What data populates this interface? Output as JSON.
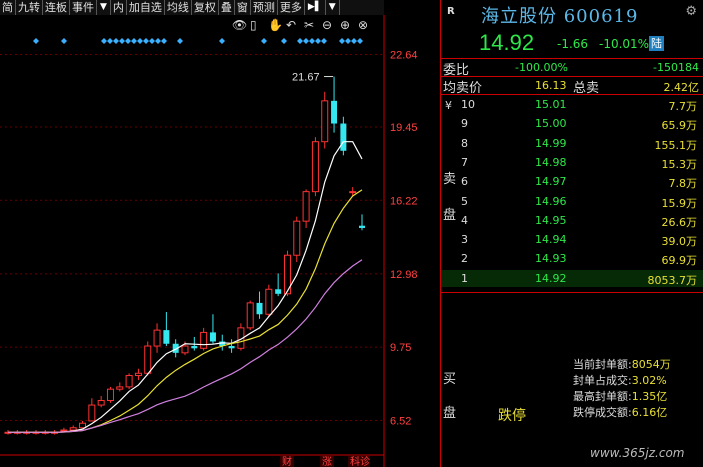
{
  "toolbar": {
    "items": [
      "简",
      "九转",
      "连板",
      "事件",
      "内",
      "加自选",
      "均线",
      "复权",
      "叠",
      "窗",
      "预测",
      "更多"
    ],
    "menu_arrow": "▼",
    "icon_glyph": "▶▌",
    "dropdown": "▼"
  },
  "chart_tools": [
    "👁",
    "▯",
    "✋",
    "↶",
    "✂",
    "⊖",
    "⊕",
    "⊗"
  ],
  "chart_data": {
    "type": "candlestick",
    "y_ticks": [
      "22.64",
      "19.45",
      "16.22",
      "12.98",
      "9.75",
      "6.52"
    ],
    "annotation": "21.67",
    "bottom_markers": [
      "财",
      "涨",
      "科诊"
    ],
    "candles": [
      {
        "o": 6.0,
        "h": 6.1,
        "l": 5.9,
        "c": 6.0
      },
      {
        "o": 6.0,
        "h": 6.1,
        "l": 5.9,
        "c": 6.0
      },
      {
        "o": 6.0,
        "h": 6.1,
        "l": 5.9,
        "c": 6.0
      },
      {
        "o": 6.0,
        "h": 6.1,
        "l": 5.9,
        "c": 6.0
      },
      {
        "o": 6.0,
        "h": 6.1,
        "l": 5.9,
        "c": 6.0
      },
      {
        "o": 6.0,
        "h": 6.1,
        "l": 5.9,
        "c": 6.0
      },
      {
        "o": 6.1,
        "h": 6.2,
        "l": 6.0,
        "c": 6.1
      },
      {
        "o": 6.1,
        "h": 6.3,
        "l": 6.1,
        "c": 6.2
      },
      {
        "o": 6.2,
        "h": 6.5,
        "l": 6.2,
        "c": 6.4
      },
      {
        "o": 6.5,
        "h": 7.5,
        "l": 6.5,
        "c": 7.2
      },
      {
        "o": 7.2,
        "h": 7.6,
        "l": 7.1,
        "c": 7.4
      },
      {
        "o": 7.4,
        "h": 8.0,
        "l": 7.3,
        "c": 7.9
      },
      {
        "o": 7.9,
        "h": 8.2,
        "l": 7.8,
        "c": 8.0
      },
      {
        "o": 8.0,
        "h": 8.6,
        "l": 7.9,
        "c": 8.5
      },
      {
        "o": 8.5,
        "h": 8.8,
        "l": 8.3,
        "c": 8.6
      },
      {
        "o": 8.6,
        "h": 10.0,
        "l": 8.5,
        "c": 9.8
      },
      {
        "o": 9.8,
        "h": 10.8,
        "l": 9.5,
        "c": 10.5
      },
      {
        "o": 10.5,
        "h": 11.3,
        "l": 9.8,
        "c": 9.9
      },
      {
        "o": 9.9,
        "h": 10.1,
        "l": 9.3,
        "c": 9.5
      },
      {
        "o": 9.5,
        "h": 10.0,
        "l": 9.4,
        "c": 9.8
      },
      {
        "o": 9.8,
        "h": 10.2,
        "l": 9.6,
        "c": 9.7
      },
      {
        "o": 9.7,
        "h": 10.6,
        "l": 9.6,
        "c": 10.4
      },
      {
        "o": 10.4,
        "h": 11.2,
        "l": 9.9,
        "c": 10.0
      },
      {
        "o": 10.0,
        "h": 10.3,
        "l": 9.6,
        "c": 9.8
      },
      {
        "o": 9.8,
        "h": 10.1,
        "l": 9.5,
        "c": 9.7
      },
      {
        "o": 9.7,
        "h": 10.8,
        "l": 9.6,
        "c": 10.6
      },
      {
        "o": 10.6,
        "h": 11.8,
        "l": 10.5,
        "c": 11.7
      },
      {
        "o": 11.7,
        "h": 12.2,
        "l": 11.0,
        "c": 11.2
      },
      {
        "o": 11.2,
        "h": 12.5,
        "l": 11.1,
        "c": 12.3
      },
      {
        "o": 12.3,
        "h": 13.0,
        "l": 12.0,
        "c": 12.1
      },
      {
        "o": 12.1,
        "h": 14.0,
        "l": 12.0,
        "c": 13.8
      },
      {
        "o": 13.8,
        "h": 15.5,
        "l": 13.5,
        "c": 15.3
      },
      {
        "o": 15.3,
        "h": 16.7,
        "l": 15.0,
        "c": 16.6
      },
      {
        "o": 16.6,
        "h": 19.0,
        "l": 16.4,
        "c": 18.8
      },
      {
        "o": 18.8,
        "h": 21.0,
        "l": 18.5,
        "c": 20.6
      },
      {
        "o": 20.6,
        "h": 21.67,
        "l": 19.2,
        "c": 19.6
      },
      {
        "o": 19.6,
        "h": 19.9,
        "l": 18.2,
        "c": 18.4
      },
      {
        "o": 16.6,
        "h": 16.8,
        "l": 16.4,
        "c": 16.6
      },
      {
        "o": 15.1,
        "h": 15.6,
        "l": 14.9,
        "c": 15.0
      }
    ]
  },
  "stock": {
    "market_tag": "R",
    "name": "海立股份",
    "code": "600619",
    "settings_icon": "⚙",
    "price": "14.92",
    "change": "-1.66",
    "change_pct": "-10.01%",
    "badge": "陆",
    "weibi_label": "委比",
    "weibi_value": "-100.00%",
    "weicha_value": "-150184",
    "avg_label": "均卖价",
    "avg_value": "16.13",
    "total_label": "总卖",
    "total_value": "2.42亿",
    "currency": "¥",
    "sell_label_1": "卖",
    "sell_label_2": "盘",
    "buy_label_1": "买",
    "buy_label_2": "盘",
    "limit_text": "跌停"
  },
  "orderbook": [
    {
      "level": "10",
      "price": "15.01",
      "vol": "7.7万"
    },
    {
      "level": "9",
      "price": "15.00",
      "vol": "65.9万"
    },
    {
      "level": "8",
      "price": "14.99",
      "vol": "155.1万"
    },
    {
      "level": "7",
      "price": "14.98",
      "vol": "15.3万"
    },
    {
      "level": "6",
      "price": "14.97",
      "vol": "7.8万"
    },
    {
      "level": "5",
      "price": "14.96",
      "vol": "15.9万"
    },
    {
      "level": "4",
      "price": "14.95",
      "vol": "26.6万"
    },
    {
      "level": "3",
      "price": "14.94",
      "vol": "39.0万"
    },
    {
      "level": "2",
      "price": "14.93",
      "vol": "69.9万"
    },
    {
      "level": "1",
      "price": "14.92",
      "vol": "8053.7万"
    }
  ],
  "seal_info": [
    {
      "label": "当前封单额:",
      "value": "8054万"
    },
    {
      "label": "封单占成交:",
      "value": "3.02%"
    },
    {
      "label": "最高封单额:",
      "value": "1.35亿"
    },
    {
      "label": "跌停成交额:",
      "value": "6.16亿"
    }
  ],
  "watermark": "www.365jz.com",
  "colors": {
    "up": "#ff3232",
    "down": "#35e8f0",
    "buy_green": "#2ee84a",
    "ma1": "#ffffff",
    "ma2": "#e8e033",
    "ma3": "#d080e0"
  }
}
